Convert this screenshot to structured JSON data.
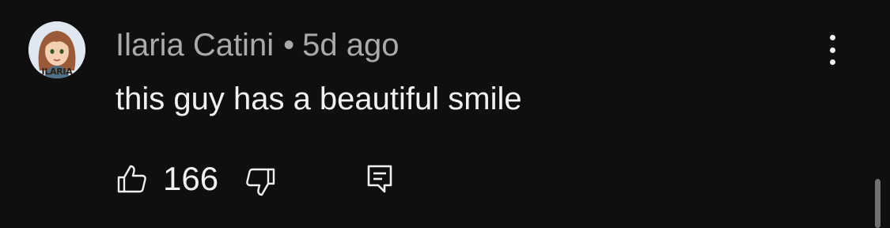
{
  "comment": {
    "author": "Ilaria Catini",
    "separator": "•",
    "time_ago": "5d ago",
    "text": "this guy has a beautiful smile",
    "like_count": "166",
    "avatar_text": "ILARIA"
  },
  "icons": {
    "like": "thumbs-up-icon",
    "dislike": "thumbs-down-icon",
    "reply": "reply-icon",
    "menu": "more-vertical-icon"
  },
  "colors": {
    "background": "#0f0f0f",
    "primary_text": "#f1f1f1",
    "secondary_text": "#aaaaaa"
  }
}
